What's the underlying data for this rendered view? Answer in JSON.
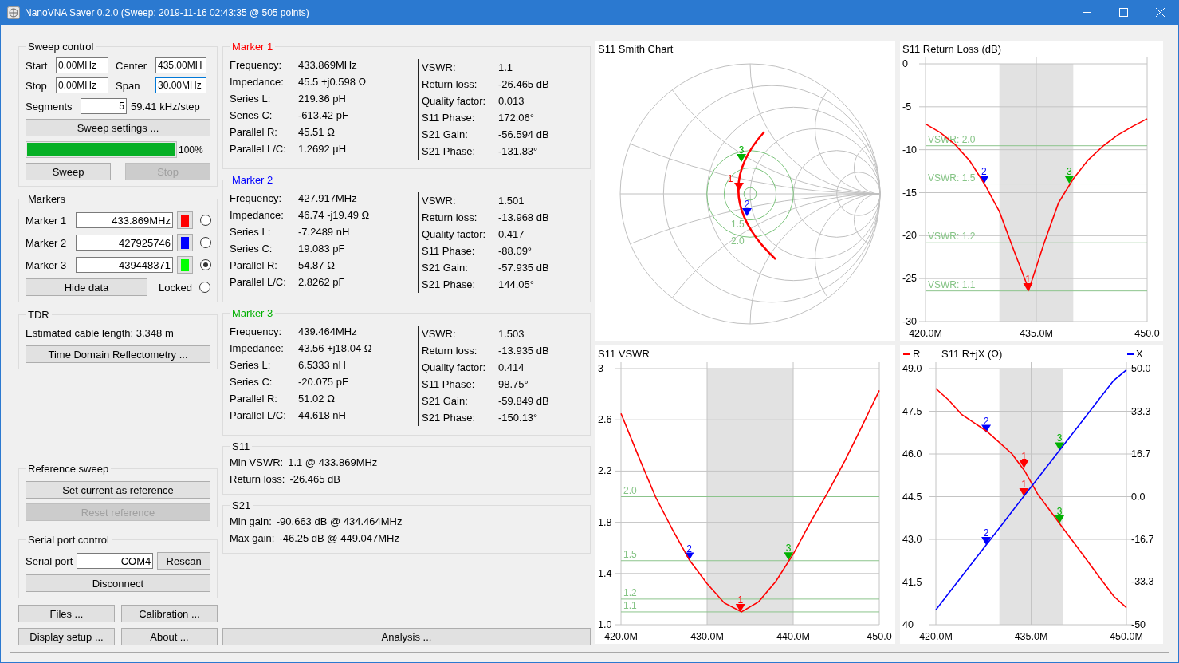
{
  "window": {
    "title": "NanoVNA Saver 0.2.0 (Sweep: 2019-11-16 02:43:35 @ 505 points)"
  },
  "sweep_control": {
    "title": "Sweep control",
    "fields": [
      {
        "label": "Start",
        "value": "0.00MHz",
        "focused": false
      },
      {
        "label": "Center",
        "value": "435.00MH",
        "focused": false
      },
      {
        "label": "Stop",
        "value": "0.00MHz",
        "focused": false
      },
      {
        "label": "Span",
        "value": "30.00MHz",
        "focused": true
      }
    ],
    "segments": {
      "label": "Segments",
      "value": "5"
    },
    "step": "59.41 kHz/step",
    "settings_button": "Sweep settings ...",
    "progress": {
      "level": 1,
      "text": "100%"
    },
    "buttons": [
      {
        "label": "Sweep",
        "disabled": false
      },
      {
        "label": "Stop",
        "disabled": true
      }
    ]
  },
  "markers": {
    "title": "Markers",
    "rows": [
      {
        "label": "Marker 1",
        "value": "433.869MHz",
        "color": "#ff0000",
        "selected": false
      },
      {
        "label": "Marker 2",
        "value": "427925746",
        "color": "#0000ff",
        "selected": false
      },
      {
        "label": "Marker 3",
        "value": "439448371",
        "color": "#00ff00",
        "selected": true
      }
    ],
    "hide_button": "Hide data",
    "locked": {
      "label": "Locked",
      "checked": false
    }
  },
  "tdr": {
    "title": "TDR",
    "text": "Estimated cable length: 3.348 m",
    "button": "Time Domain Reflectometry ..."
  },
  "reference_sweep": {
    "title": "Reference sweep",
    "buttons": [
      {
        "label": "Set current as reference",
        "disabled": false
      },
      {
        "label": "Reset reference",
        "disabled": true
      }
    ]
  },
  "serial_port": {
    "title": "Serial port control",
    "label": "Serial port",
    "value": "COM4",
    "rescan": "Rescan",
    "disconnect": "Disconnect"
  },
  "bottom_buttons": [
    "Files ...",
    "Calibration ...",
    "Display setup ...",
    "About ..."
  ],
  "marker_panels": [
    {
      "title": "Marker 1",
      "color": "#ff0000",
      "left": [
        {
          "label": "Frequency:",
          "value": "433.869MHz"
        },
        {
          "label": "Impedance:",
          "value": "45.5 +j0.598 Ω"
        },
        {
          "label": "Series L:",
          "value": "219.36 pH"
        },
        {
          "label": "Series C:",
          "value": "-613.42 pF"
        },
        {
          "label": "Parallel R:",
          "value": "45.51 Ω"
        },
        {
          "label": "Parallel L/C:",
          "value": "1.2692 µH"
        }
      ],
      "right": [
        {
          "label": "VSWR:",
          "value": "1.1"
        },
        {
          "label": "Return loss:",
          "value": "-26.465 dB"
        },
        {
          "label": "Quality factor:",
          "value": "0.013"
        },
        {
          "label": "S11 Phase:",
          "value": "172.06°"
        },
        {
          "label": "S21 Gain:",
          "value": "-56.594 dB"
        },
        {
          "label": "S21 Phase:",
          "value": "-131.83°"
        }
      ]
    },
    {
      "title": "Marker 2",
      "color": "#0000ff",
      "left": [
        {
          "label": "Frequency:",
          "value": "427.917MHz"
        },
        {
          "label": "Impedance:",
          "value": "46.74 -j19.49 Ω"
        },
        {
          "label": "Series L:",
          "value": "-7.2489 nH"
        },
        {
          "label": "Series C:",
          "value": "19.083 pF"
        },
        {
          "label": "Parallel R:",
          "value": "54.87 Ω"
        },
        {
          "label": "Parallel L/C:",
          "value": "2.8262 pF"
        }
      ],
      "right": [
        {
          "label": "VSWR:",
          "value": "1.501"
        },
        {
          "label": "Return loss:",
          "value": "-13.968 dB"
        },
        {
          "label": "Quality factor:",
          "value": "0.417"
        },
        {
          "label": "S11 Phase:",
          "value": "-88.09°"
        },
        {
          "label": "S21 Gain:",
          "value": "-57.935 dB"
        },
        {
          "label": "S21 Phase:",
          "value": "144.05°"
        }
      ]
    },
    {
      "title": "Marker 3",
      "color": "#00b000",
      "left": [
        {
          "label": "Frequency:",
          "value": "439.464MHz"
        },
        {
          "label": "Impedance:",
          "value": "43.56 +j18.04 Ω"
        },
        {
          "label": "Series L:",
          "value": "6.5333 nH"
        },
        {
          "label": "Series C:",
          "value": "-20.075 pF"
        },
        {
          "label": "Parallel R:",
          "value": "51.02 Ω"
        },
        {
          "label": "Parallel L/C:",
          "value": "44.618 nH"
        }
      ],
      "right": [
        {
          "label": "VSWR:",
          "value": "1.503"
        },
        {
          "label": "Return loss:",
          "value": "-13.935 dB"
        },
        {
          "label": "Quality factor:",
          "value": "0.414"
        },
        {
          "label": "S11 Phase:",
          "value": "98.75°"
        },
        {
          "label": "S21 Gain:",
          "value": "-59.849 dB"
        },
        {
          "label": "S21 Phase:",
          "value": "-150.13°"
        }
      ]
    }
  ],
  "s11": {
    "title": "S11",
    "rows": [
      {
        "label": "Min VSWR:",
        "value": "1.1 @ 433.869MHz"
      },
      {
        "label": "Return loss:",
        "value": "-26.465 dB"
      }
    ]
  },
  "s21": {
    "title": "S21",
    "rows": [
      {
        "label": "Min gain:",
        "value": "-90.663 dB @ 434.464MHz"
      },
      {
        "label": "Max gain:",
        "value": "-46.25 dB @ 449.047MHz"
      }
    ]
  },
  "analysis_button": "Analysis ...",
  "charts": [
    {
      "kind": "smith",
      "title": "S11 Smith Chart",
      "vswr_circle_labels": [
        "1.5",
        "2.0"
      ],
      "markers": [
        {
          "label": "1",
          "color": "#ff0000"
        },
        {
          "label": "2",
          "color": "#0000ff"
        },
        {
          "label": "3",
          "color": "#00b000"
        }
      ]
    },
    {
      "kind": "plot",
      "chart_data": {
        "type": "line",
        "title": "S11 Return Loss (dB)",
        "grid": true,
        "x": [
          420,
          422,
          424,
          426,
          428,
          430,
          432,
          434,
          436,
          438,
          440,
          442,
          444,
          446,
          448,
          450
        ],
        "xlim": [
          420,
          450
        ],
        "ylim": [
          -30,
          0
        ],
        "xticks": [
          {
            "value": 420,
            "label": "420.0M"
          },
          {
            "value": 435,
            "label": "435.0M"
          },
          {
            "value": 450,
            "label": "450.0"
          }
        ],
        "yticks": [
          {
            "value": 0,
            "label": "0"
          },
          {
            "value": -5,
            "label": "-5"
          },
          {
            "value": -10,
            "label": "-10"
          },
          {
            "value": -15,
            "label": "-15"
          },
          {
            "value": -20,
            "label": "-20"
          },
          {
            "value": -25,
            "label": "-25"
          },
          {
            "value": -30,
            "label": "-30"
          }
        ],
        "series": [
          {
            "color": "#ff0000",
            "values": [
              -7.0,
              -8.0,
              -9.4,
              -11.3,
              -14.0,
              -17.2,
              -21.8,
              -26.3,
              -21.0,
              -16.2,
              -13.4,
              -11.2,
              -9.6,
              -8.3,
              -7.3,
              -6.4
            ]
          }
        ],
        "bands": [
          {
            "axis": "x",
            "from": 430,
            "to": 440
          }
        ],
        "ref_lines": [
          {
            "axis": "y",
            "value": -9.54
          },
          {
            "axis": "y",
            "value": -13.98
          },
          {
            "axis": "y",
            "value": -20.83
          },
          {
            "axis": "y",
            "value": -26.44
          }
        ],
        "annotations": [
          {
            "text": "2",
            "x": 427.917,
            "y": -13.968
          },
          {
            "text": "3",
            "x": 439.464,
            "y": -13.935
          },
          {
            "text": "1",
            "x": 433.869,
            "y": -26.465
          }
        ]
      },
      "ref_line_labels": [
        "VSWR: 2.0",
        "VSWR: 1.5",
        "VSWR: 1.2",
        "VSWR: 1.1"
      ],
      "marker_styles": [
        {
          "color": "#0000ff"
        },
        {
          "color": "#00b000"
        },
        {
          "color": "#ff0000"
        }
      ]
    },
    {
      "kind": "plot",
      "chart_data": {
        "type": "line",
        "title": "S11 VSWR",
        "grid": true,
        "x": [
          420,
          422,
          424,
          426,
          428,
          430,
          432,
          434,
          436,
          438,
          440,
          442,
          444,
          446,
          448,
          450
        ],
        "xlim": [
          420,
          450
        ],
        "ylim": [
          1,
          3
        ],
        "xticks": [
          {
            "value": 420,
            "label": "420.0M"
          },
          {
            "value": 430,
            "label": "430.0M"
          },
          {
            "value": 440,
            "label": "440.0M"
          },
          {
            "value": 450,
            "label": "450.0"
          }
        ],
        "yticks": [
          {
            "value": 1,
            "label": "1.0"
          },
          {
            "value": 1.4,
            "label": "1.4"
          },
          {
            "value": 1.8,
            "label": "1.8"
          },
          {
            "value": 2.2,
            "label": "2.2"
          },
          {
            "value": 2.6,
            "label": "2.6"
          },
          {
            "value": 3,
            "label": "3"
          }
        ],
        "series": [
          {
            "color": "#ff0000",
            "values": [
              2.65,
              2.32,
              2.0,
              1.74,
              1.5,
              1.32,
              1.17,
              1.1,
              1.18,
              1.34,
              1.55,
              1.8,
              2.03,
              2.28,
              2.55,
              2.83
            ]
          }
        ],
        "bands": [
          {
            "axis": "x",
            "from": 430,
            "to": 440
          }
        ],
        "ref_lines": [
          {
            "axis": "y",
            "value": 2.0
          },
          {
            "axis": "y",
            "value": 1.5
          },
          {
            "axis": "y",
            "value": 1.2
          },
          {
            "axis": "y",
            "value": 1.1
          }
        ],
        "annotations": [
          {
            "text": "2",
            "x": 427.917,
            "y": 1.501
          },
          {
            "text": "3",
            "x": 439.464,
            "y": 1.503
          },
          {
            "text": "1",
            "x": 433.869,
            "y": 1.1
          }
        ]
      },
      "ref_line_labels": [
        "2.0",
        "1.5",
        "1.2",
        "1.1"
      ],
      "marker_styles": [
        {
          "color": "#0000ff"
        },
        {
          "color": "#00b000"
        },
        {
          "color": "#ff0000"
        }
      ]
    },
    {
      "kind": "plot",
      "chart_data": {
        "type": "line",
        "title": "S11 R+jX (Ω)",
        "grid": true,
        "legend": "top",
        "x": [
          420,
          422,
          424,
          426,
          428,
          430,
          432,
          434,
          436,
          438,
          440,
          442,
          444,
          446,
          448,
          450
        ],
        "xlim": [
          420,
          450
        ],
        "ylim": [
          40,
          49
        ],
        "y2lim": [
          -50,
          50
        ],
        "xticks": [
          {
            "value": 420,
            "label": "420.0M"
          },
          {
            "value": 435,
            "label": "435.0M"
          },
          {
            "value": 450,
            "label": "450.0M"
          }
        ],
        "yticks": [
          {
            "value": 40,
            "label": "40"
          },
          {
            "value": 41.5,
            "label": "41.5"
          },
          {
            "value": 43,
            "label": "43.0"
          },
          {
            "value": 44.5,
            "label": "44.5"
          },
          {
            "value": 46,
            "label": "46.0"
          },
          {
            "value": 47.5,
            "label": "47.5"
          },
          {
            "value": 49,
            "label": "49.0"
          }
        ],
        "y2ticks": [
          {
            "value": -50,
            "label": "-50"
          },
          {
            "value": -33.3,
            "label": "-33.3"
          },
          {
            "value": -16.7,
            "label": "-16.7"
          },
          {
            "value": 0,
            "label": "0.0"
          },
          {
            "value": 16.7,
            "label": "16.7"
          },
          {
            "value": 33.3,
            "label": "33.3"
          },
          {
            "value": 50,
            "label": "50.0"
          }
        ],
        "series": [
          {
            "name": "R",
            "color": "#ff0000",
            "values": [
              48.3,
              47.9,
              47.4,
              47.1,
              46.8,
              46.4,
              46.0,
              45.4,
              44.6,
              44.0,
              43.4,
              42.8,
              42.2,
              41.6,
              41.0,
              40.6
            ]
          },
          {
            "name": "X",
            "color": "#0000ff",
            "axis": "y2",
            "values": [
              -44.2,
              -37.8,
              -31.4,
              -25.0,
              -18.6,
              -12.2,
              -5.8,
              0.6,
              7.0,
              13.4,
              19.8,
              26.2,
              32.6,
              39.0,
              45.4,
              49.5
            ]
          }
        ],
        "bands": [
          {
            "axis": "x",
            "from": 430,
            "to": 440
          }
        ],
        "annotations": [
          {
            "text": "2",
            "x": 427.917,
            "y": 46.74
          },
          {
            "text": "1",
            "x": 433.869,
            "y": 45.5
          },
          {
            "text": "3",
            "x": 439.464,
            "y": 43.56
          },
          "2",
          "1",
          "3"
        ]
      },
      "marker_styles": [
        {
          "color": "#0000ff"
        },
        {
          "color": "#ff0000"
        },
        {
          "color": "#00b000"
        },
        {
          "color": "#0000ff"
        },
        {
          "color": "#ff0000"
        },
        {
          "color": "#00b000"
        }
      ]
    }
  ]
}
